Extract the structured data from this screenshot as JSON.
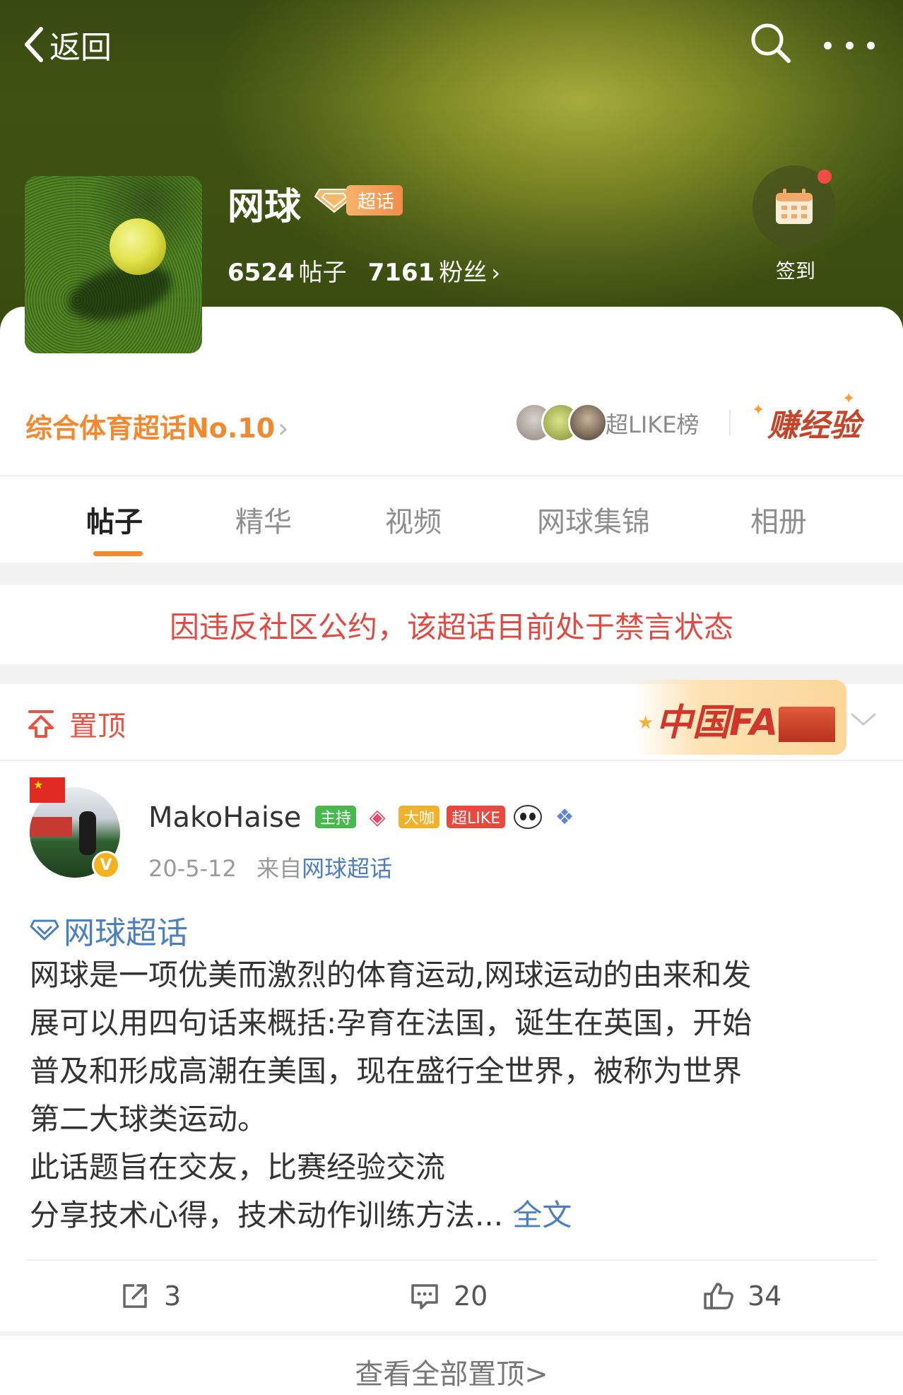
{
  "header": {
    "back_label": "返回",
    "title": "网球",
    "super_badge": "超话",
    "posts_count": "6524",
    "posts_label": "帖子",
    "fans_count": "7161",
    "fans_label": "粉丝",
    "signin_label": "签到"
  },
  "summary": {
    "rank_text": "综合体育超话No.10",
    "like_label": "超LIKE榜",
    "earn_label": "赚经验"
  },
  "tabs": [
    {
      "label": "帖子",
      "active": true
    },
    {
      "label": "精华",
      "active": false
    },
    {
      "label": "视频",
      "active": false
    },
    {
      "label": "网球集锦",
      "active": false
    },
    {
      "label": "相册",
      "active": false
    }
  ],
  "notice": "因违反社区公约，该超话目前处于禁言状态",
  "pinned": {
    "label": "置顶",
    "banner_text": "中国FANS"
  },
  "post": {
    "username": "MakoHaise",
    "badges": {
      "host": "主持",
      "daka": "大咖",
      "chaolike": "超LIKE"
    },
    "date": "20-5-12",
    "from_prefix": "来自",
    "from_source": "网球超话",
    "topic_tag": "网球超话",
    "lines": [
      "网球是一项优美而激烈的体育运动,网球运动的由来和发",
      "展可以用四句话来概括:孕育在法国，诞生在英国，开始",
      "普及和形成高潮在美国，现在盛行全世界，被称为世界",
      "第二大球类运动。",
      "此话题旨在交友，比赛经验交流",
      "分享技术心得，技术动作训练方法..."
    ],
    "full_text_link": "全文",
    "shares": "3",
    "comments": "20",
    "likes": "34"
  },
  "view_all_pinned": "查看全部置顶>",
  "colors": {
    "accent_orange": "#f3892f",
    "notice_red": "#e14a40",
    "link_blue": "#4a7fc1",
    "header_green": "#7f8b25"
  }
}
